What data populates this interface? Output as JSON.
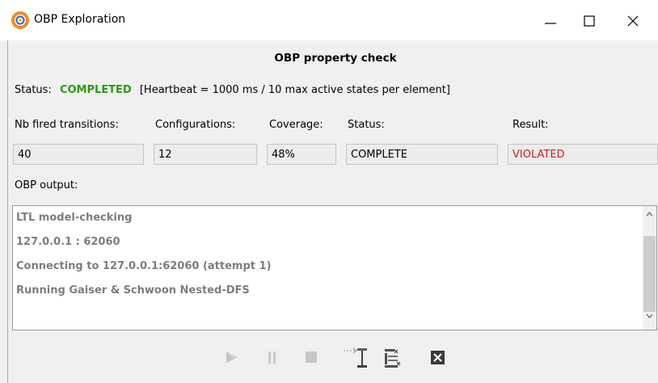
{
  "window": {
    "title": "OBP Exploration"
  },
  "heading": "OBP property check",
  "status": {
    "label": "Status:",
    "value": "COMPLETED",
    "details": "[Heartbeat = 1000 ms / 10 max active states per element]",
    "value_color": "#2a9a12"
  },
  "columns": [
    {
      "label": "Nb fired transitions:",
      "value": "40"
    },
    {
      "label": "Configurations:",
      "value": "12"
    },
    {
      "label": "Coverage:",
      "value": "48%"
    },
    {
      "label": "Status:",
      "value": "COMPLETE"
    },
    {
      "label": "Result:",
      "value": "VIOLATED",
      "value_color": "#d0201c"
    }
  ],
  "output": {
    "label": "OBP output:",
    "lines": [
      "LTL model-checking",
      "127.0.0.1 : 62060",
      "Connecting to 127.0.0.1:62060 (attempt 1)",
      "Running Gaiser & Schwoon Nested-DFS"
    ]
  },
  "toolbar": {
    "icons": [
      "play-icon",
      "pause-icon",
      "stop-icon",
      "step-icon",
      "filter-icon",
      "close-icon"
    ]
  },
  "window_controls": [
    "minimize-icon",
    "maximize-icon",
    "close-icon"
  ]
}
